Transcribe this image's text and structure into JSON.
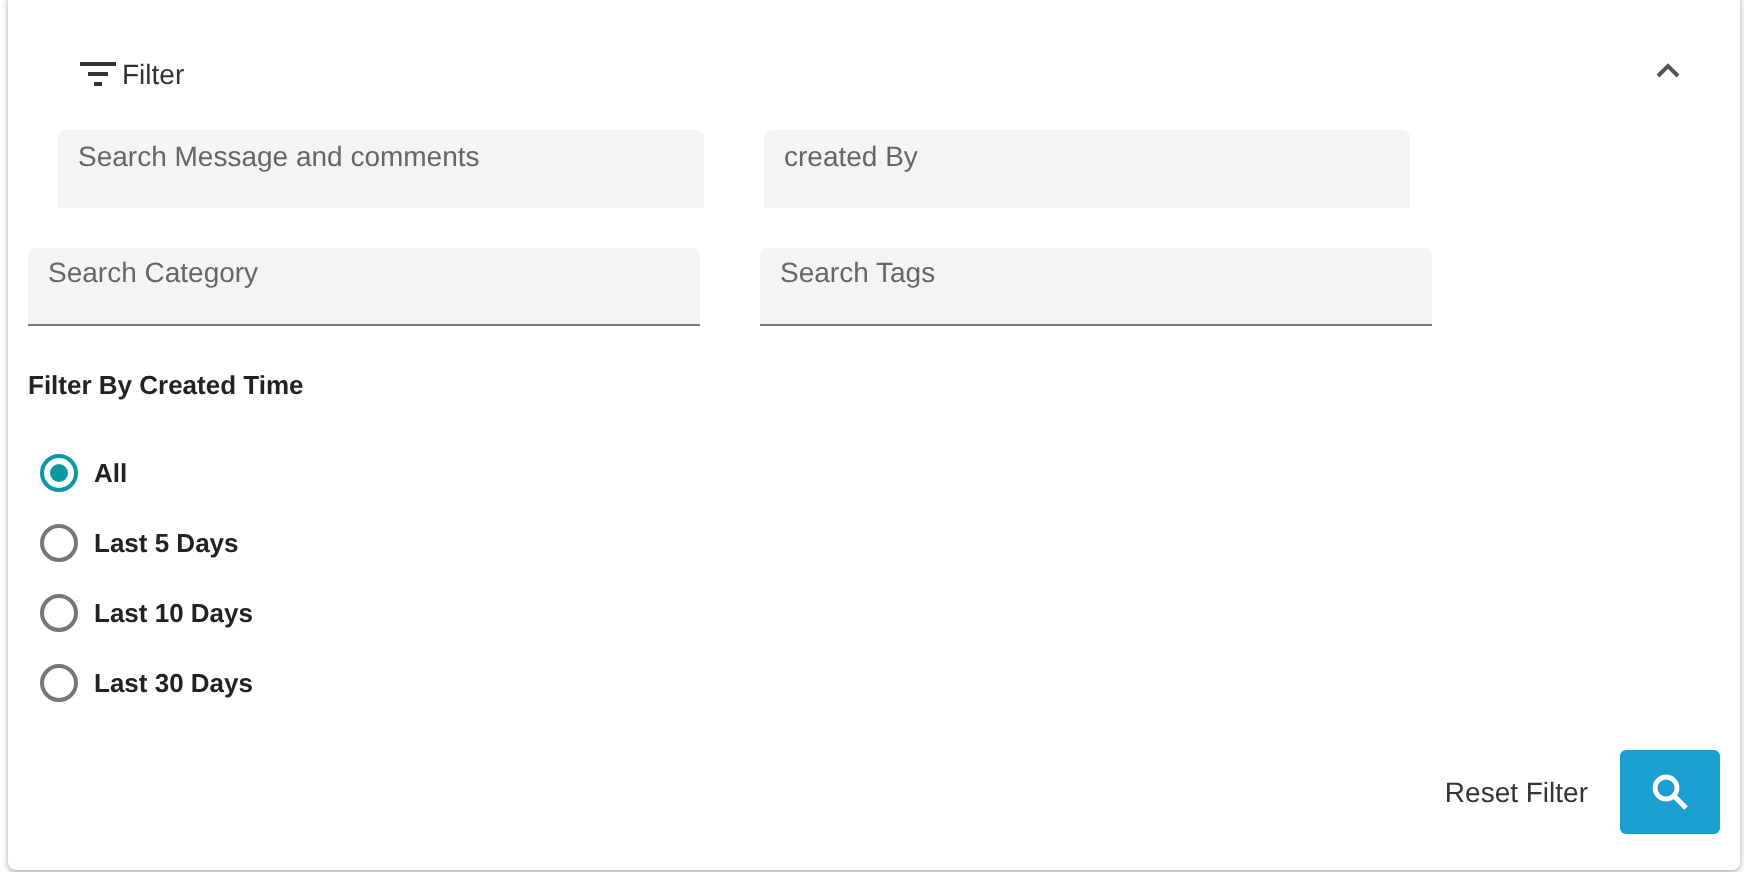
{
  "header": {
    "title": "Filter",
    "expanded": true
  },
  "field_rows": [
    {
      "fields": [
        {
          "placeholder": "Search Message and comments",
          "underlined": false
        },
        {
          "placeholder": "created By",
          "underlined": false
        }
      ]
    },
    {
      "fields": [
        {
          "placeholder": "Search Category",
          "underlined": true
        },
        {
          "placeholder": "Search Tags",
          "underlined": true
        }
      ]
    }
  ],
  "time_filter": {
    "heading": "Filter By Created Time",
    "options": [
      {
        "label": "All",
        "selected": true
      },
      {
        "label": "Last 5 Days",
        "selected": false
      },
      {
        "label": "Last 10 Days",
        "selected": false
      },
      {
        "label": "Last 30 Days",
        "selected": false
      }
    ]
  },
  "actions": {
    "reset": "Reset Filter"
  }
}
